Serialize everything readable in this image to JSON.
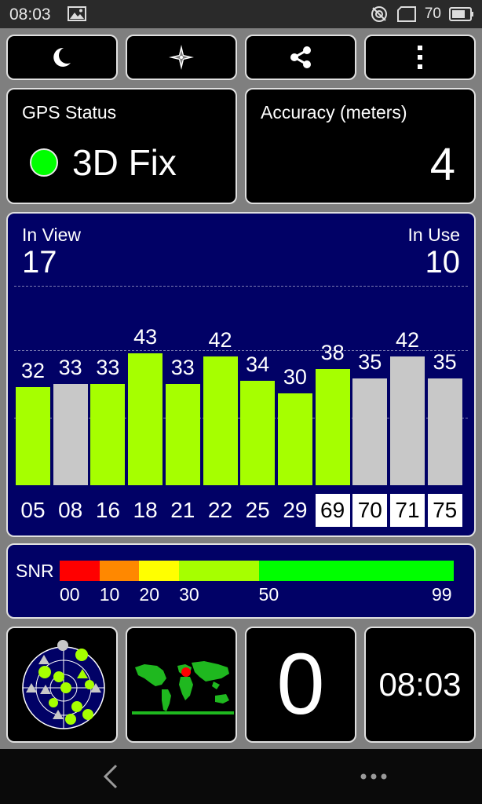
{
  "status_bar": {
    "time": "08:03",
    "battery_percent": "70",
    "icons": [
      "image-icon",
      "location-off-icon",
      "sim-card-icon",
      "battery-icon"
    ]
  },
  "toolbar": {
    "buttons": [
      {
        "icon": "night-mode-icon"
      },
      {
        "icon": "compass-icon"
      },
      {
        "icon": "share-icon"
      },
      {
        "icon": "overflow-menu-icon"
      }
    ]
  },
  "gps_status": {
    "label": "GPS Status",
    "value": "3D Fix",
    "indicator_color": "#00ff00"
  },
  "accuracy": {
    "label": "Accuracy (meters)",
    "value": "4"
  },
  "satellites": {
    "in_view_label": "In View",
    "in_view": "17",
    "in_use_label": "In Use",
    "in_use": "10",
    "colors": {
      "in_use": "#a6ff00",
      "not_used": "#c8c8c8",
      "background": "#010166"
    },
    "bars": [
      {
        "prn": "05",
        "snr": "32",
        "used": true
      },
      {
        "prn": "08",
        "snr": "33",
        "used": false
      },
      {
        "prn": "16",
        "snr": "33",
        "used": true
      },
      {
        "prn": "18",
        "snr": "43",
        "used": true
      },
      {
        "prn": "21",
        "snr": "33",
        "used": true
      },
      {
        "prn": "22",
        "snr": "42",
        "used": true
      },
      {
        "prn": "25",
        "snr": "34",
        "used": true
      },
      {
        "prn": "29",
        "snr": "30",
        "used": true
      },
      {
        "prn": "69",
        "snr": "38",
        "used": true
      },
      {
        "prn": "70",
        "snr": "35",
        "used": false
      },
      {
        "prn": "71",
        "snr": "42",
        "used": false
      },
      {
        "prn": "75",
        "snr": "35",
        "used": false
      }
    ]
  },
  "snr_legend": {
    "label": "SNR",
    "segments": [
      {
        "from": 0,
        "to": 10,
        "color": "#ff0000"
      },
      {
        "from": 10,
        "to": 20,
        "color": "#ff8800"
      },
      {
        "from": 20,
        "to": 30,
        "color": "#ffff00"
      },
      {
        "from": 30,
        "to": 50,
        "color": "#a6ff00"
      },
      {
        "from": 50,
        "to": 99,
        "color": "#00ff00"
      }
    ],
    "ticks": [
      "00",
      "10",
      "20",
      "30",
      "50",
      "99"
    ]
  },
  "bottom": {
    "radar_icon": "sky-radar-icon",
    "map_icon": "world-map-icon",
    "counter": "0",
    "clock": "08:03"
  },
  "nav_bar": {
    "back_icon": "back-icon",
    "more_icon": "more-dots-icon"
  }
}
